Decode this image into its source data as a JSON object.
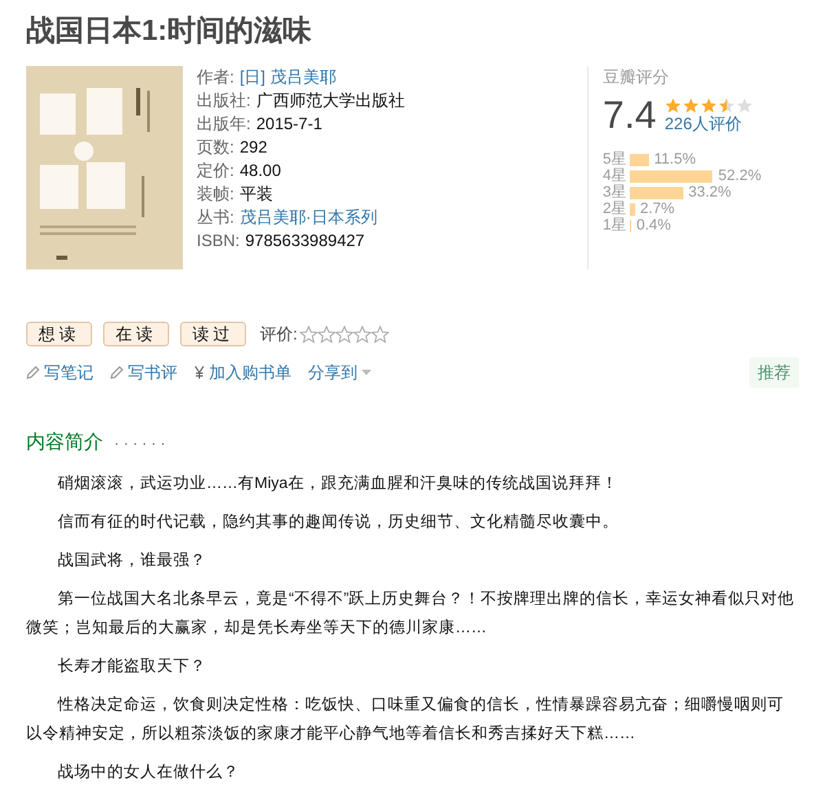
{
  "title": "战国日本1:时间的滋味",
  "cover": {
    "kind": "picture"
  },
  "info": [
    {
      "label": "作者:",
      "value": "[日] 茂吕美耶",
      "link": true
    },
    {
      "label": "出版社:",
      "value": "广西师范大学出版社",
      "link": false
    },
    {
      "label": "出版年:",
      "value": "2015-7-1",
      "link": false
    },
    {
      "label": "页数:",
      "value": "292",
      "link": false
    },
    {
      "label": "定价:",
      "value": "48.00",
      "link": false
    },
    {
      "label": "装帧:",
      "value": "平装",
      "link": false
    },
    {
      "label": "丛书:",
      "value": "茂吕美耶·日本系列",
      "link": true
    },
    {
      "label": "ISBN:",
      "value": "9785633989427",
      "link": false
    }
  ],
  "rating": {
    "heading": "豆瓣评分",
    "score": "7.4",
    "stars": 3.5,
    "count": "226人评价",
    "distribution": [
      {
        "label": "5星",
        "percent": "11.5%"
      },
      {
        "label": "4星",
        "percent": "52.2%"
      },
      {
        "label": "3星",
        "percent": "33.2%"
      },
      {
        "label": "2星",
        "percent": "2.7%"
      },
      {
        "label": "1星",
        "percent": "0.4%"
      }
    ]
  },
  "status_buttons": [
    "想读",
    "在读",
    "读过"
  ],
  "my_rating": {
    "label": "评价:",
    "stars": 0
  },
  "actions": [
    {
      "kind": "pencil",
      "label": "写笔记"
    },
    {
      "kind": "pencil",
      "label": "写书评"
    },
    {
      "kind": "yen",
      "label": "加入购书单"
    },
    {
      "kind": "dropdown",
      "label": "分享到"
    }
  ],
  "recommend": "推荐",
  "intro": {
    "heading": "内容简介",
    "dots": "· · · · · ·",
    "paragraphs": [
      "硝烟滚滚，武运功业……有Miya在，跟充满血腥和汗臭味的传统战国说拜拜！",
      "信而有征的时代记载，隐约其事的趣闻传说，历史细节、文化精髓尽收囊中。",
      "战国武将，谁最强？",
      "第一位战国大名北条早云，竟是“不得不”跃上历史舞台？！不按牌理出牌的信长，幸运女神看似只对他微笑；岂知最后的大赢家，却是凭长寿坐等天下的德川家康……",
      "长寿才能盗取天下？",
      "性格决定命运，饮食则决定性格：吃饭快、口味重又偏食的信长，性情暴躁容易亢奋；细嚼慢咽则可以令精神安定，所以粗茶淡饭的家康才能平心静气地等着信长和秀吉揉好天下糕……",
      "战场中的女人在做什么？"
    ]
  }
}
